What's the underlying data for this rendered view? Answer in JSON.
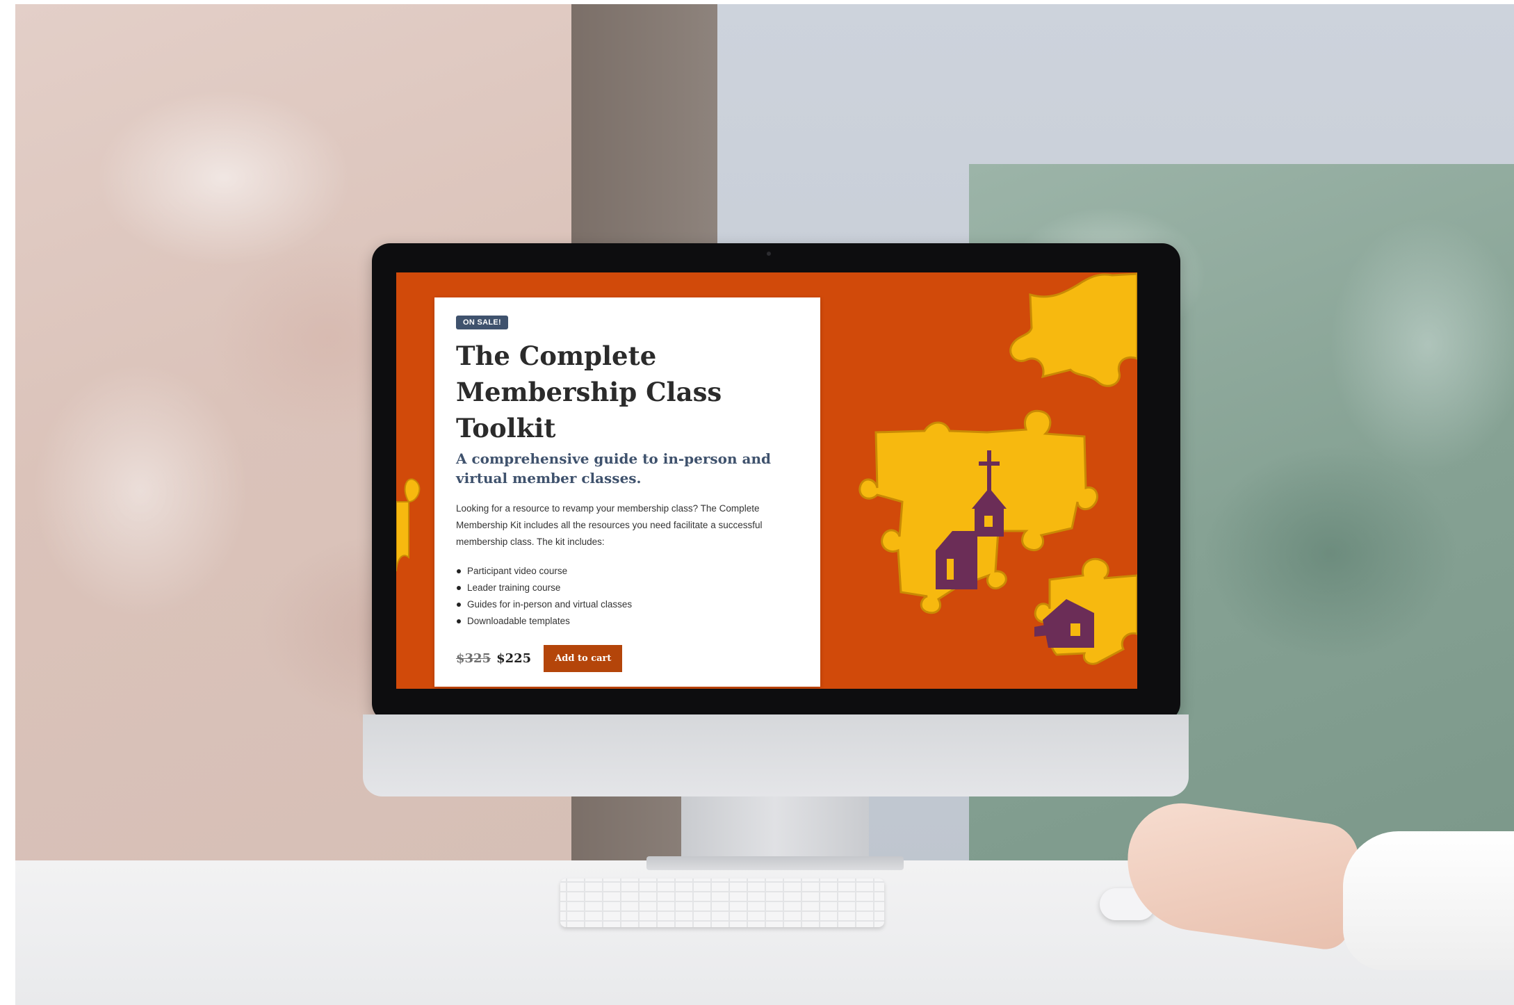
{
  "product": {
    "badge": "ON SALE!",
    "title": "The Complete Membership Class Toolkit",
    "subtitle": "A comprehensive guide to in-person and virtual member classes.",
    "description": "Looking for a resource to revamp your membership class? The Complete Membership Kit includes all the resources you need facilitate a successful membership class. The kit includes:",
    "features": [
      "Participant video course",
      "Leader training course",
      "Guides for in-person and virtual classes",
      "Downloadable templates"
    ],
    "original_price": "$325",
    "sale_price": "$225",
    "cart_button_label": "Add to cart"
  },
  "colors": {
    "hero_background": "#d14a0a",
    "puzzle_yellow": "#f7b90f",
    "church_purple": "#6b2d57",
    "badge_blue": "#3f526d",
    "button_orange": "#b4450a"
  },
  "icons": [
    "puzzle-piece-icon",
    "church-icon",
    "house-icon"
  ]
}
